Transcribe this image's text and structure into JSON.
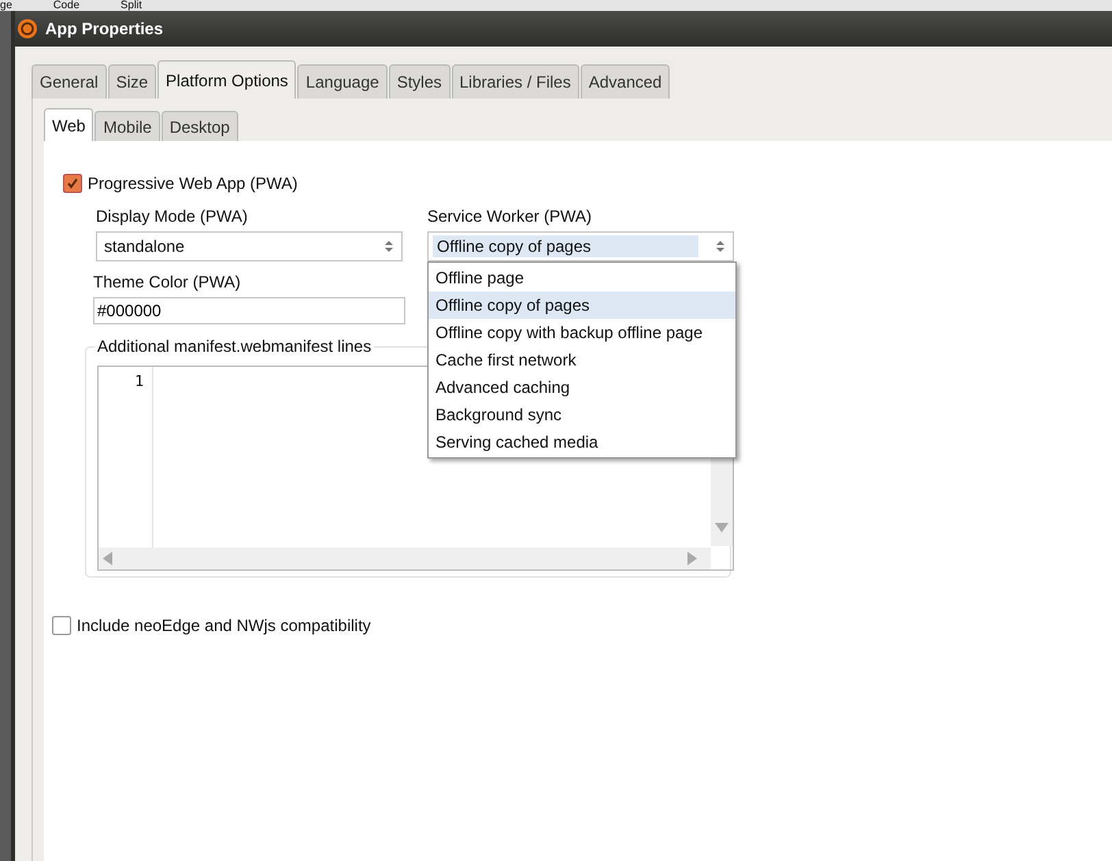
{
  "background_toolbar": [
    "ge",
    "Code",
    "Split"
  ],
  "window": {
    "title": "App Properties"
  },
  "tabs": [
    {
      "label": "General",
      "selected": false
    },
    {
      "label": "Size",
      "selected": false
    },
    {
      "label": "Platform Options",
      "selected": true
    },
    {
      "label": "Language",
      "selected": false
    },
    {
      "label": "Styles",
      "selected": false
    },
    {
      "label": "Libraries / Files",
      "selected": false
    },
    {
      "label": "Advanced",
      "selected": false
    }
  ],
  "subtabs": [
    {
      "label": "Web",
      "selected": true
    },
    {
      "label": "Mobile",
      "selected": false
    },
    {
      "label": "Desktop",
      "selected": false
    }
  ],
  "pwa": {
    "label": "Progressive Web App (PWA)",
    "checked": true
  },
  "display_mode": {
    "label": "Display Mode (PWA)",
    "value": "standalone"
  },
  "service_worker": {
    "label": "Service Worker (PWA)",
    "value": "Offline copy of pages",
    "options": [
      {
        "label": "Offline page",
        "selected": false
      },
      {
        "label": "Offline copy of pages",
        "selected": true
      },
      {
        "label": "Offline copy with backup offline page",
        "selected": false
      },
      {
        "label": "Cache first network",
        "selected": false
      },
      {
        "label": "Advanced caching",
        "selected": false
      },
      {
        "label": "Background sync",
        "selected": false
      },
      {
        "label": "Serving cached media",
        "selected": false
      }
    ]
  },
  "theme_color": {
    "label": "Theme Color (PWA)",
    "value": "#000000"
  },
  "manifest": {
    "label": "Additional manifest.webmanifest lines",
    "line_numbers": [
      "1"
    ]
  },
  "compat": {
    "label": "Include neoEdge and NWjs compatibility",
    "checked": false
  }
}
